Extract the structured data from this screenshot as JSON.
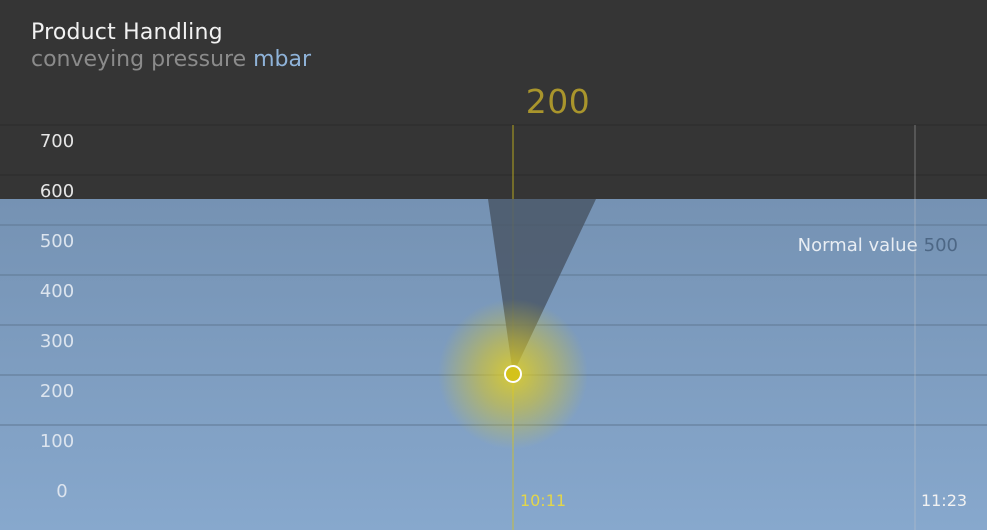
{
  "header": {
    "title": "Product Handling",
    "subtitle": "conveying pressure",
    "unit": "mbar"
  },
  "current_value": "200",
  "normal": {
    "label": "Normal value",
    "value": "500"
  },
  "colors": {
    "accent": "#d4c21a",
    "value_text": "#a9952c",
    "normal_zone": "#7f9fc2",
    "background": "#353535",
    "unit": "#8fb3d9"
  },
  "chart_data": {
    "type": "line",
    "title": "Product Handling",
    "ylabel": "conveying pressure mbar",
    "ylim": [
      0,
      700
    ],
    "yticks": [
      0,
      100,
      200,
      300,
      400,
      500,
      600,
      700
    ],
    "grid": true,
    "normal_value": 500,
    "x_labels": [
      "10:11",
      "11:23"
    ],
    "series": [
      {
        "x": [
          "10:11"
        ],
        "y": [
          230
        ]
      }
    ]
  }
}
